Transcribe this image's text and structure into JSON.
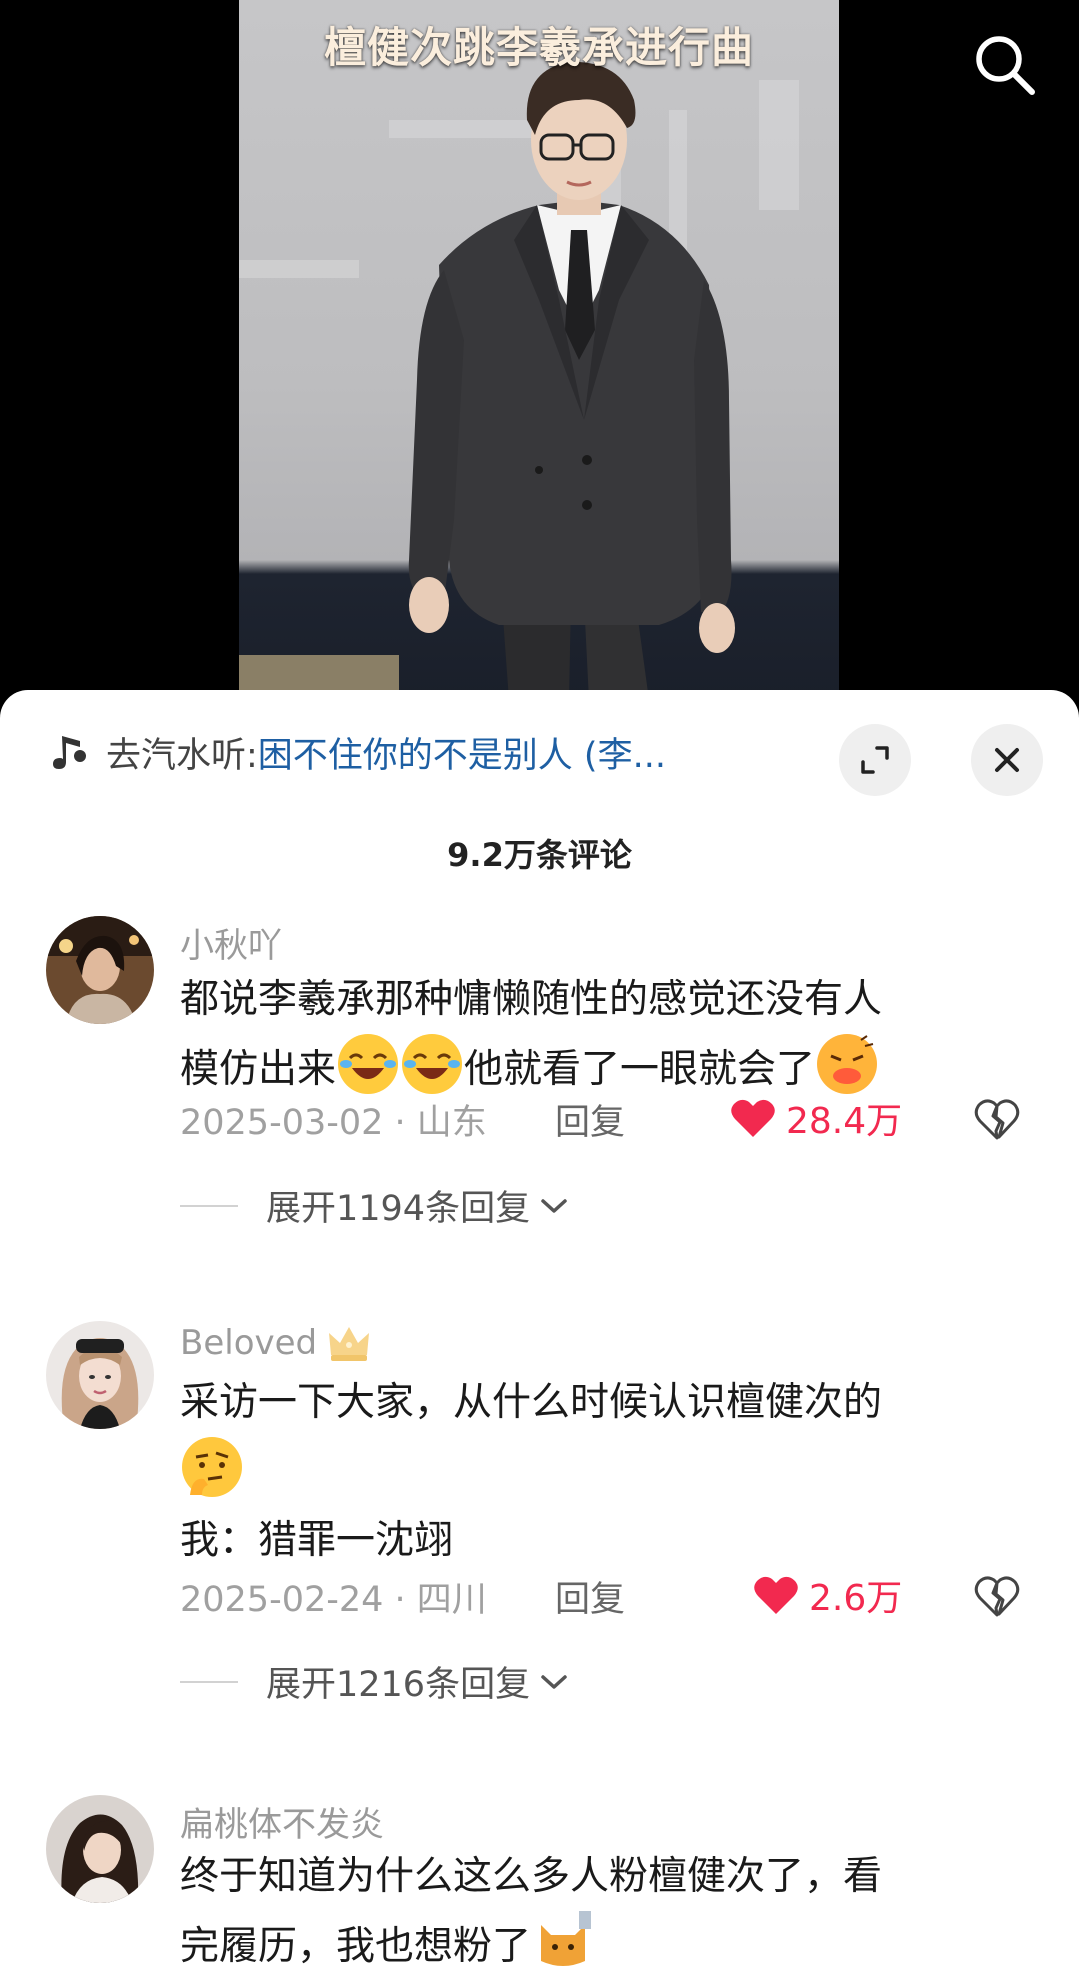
{
  "video": {
    "title": "檀健次跳李羲承进行曲",
    "search_icon": "search-icon"
  },
  "panel": {
    "music_prefix": "去汽水听: ",
    "music_song": "困不住你的不是别人 (李...",
    "music_icon": "music-note-icon",
    "expand_icon": "expand-icon",
    "close_icon": "close-icon",
    "comment_count": "9.2万条评论"
  },
  "comments": [
    {
      "username": "小秋吖",
      "text_line1": "都说李羲承那种慵懒随性的感觉还没有人",
      "text_line2": "模仿出来",
      "text_line2_after": "他就看了一眼就会了",
      "date_location": "2025-03-02 · 山东",
      "reply_label": "回复",
      "likes": "28.4万",
      "expand_label": "展开1194条回复"
    },
    {
      "username": "Beloved",
      "text_line1": "采访一下大家，从什么时候认识檀健次的",
      "text_line3": "我：猎罪一沈翊",
      "date_location": "2025-02-24 · 四川",
      "reply_label": "回复",
      "likes": "2.6万",
      "expand_label": "展开1216条回复"
    },
    {
      "username": "扁桃体不发炎",
      "text_line1": "终于知道为什么这么多人粉檀健次了，看",
      "text_line2": "完履历，我也想粉了"
    }
  ],
  "colors": {
    "like_red": "#f2294f",
    "link_blue": "#1e5fa3",
    "title_text": "#fbeedd"
  }
}
